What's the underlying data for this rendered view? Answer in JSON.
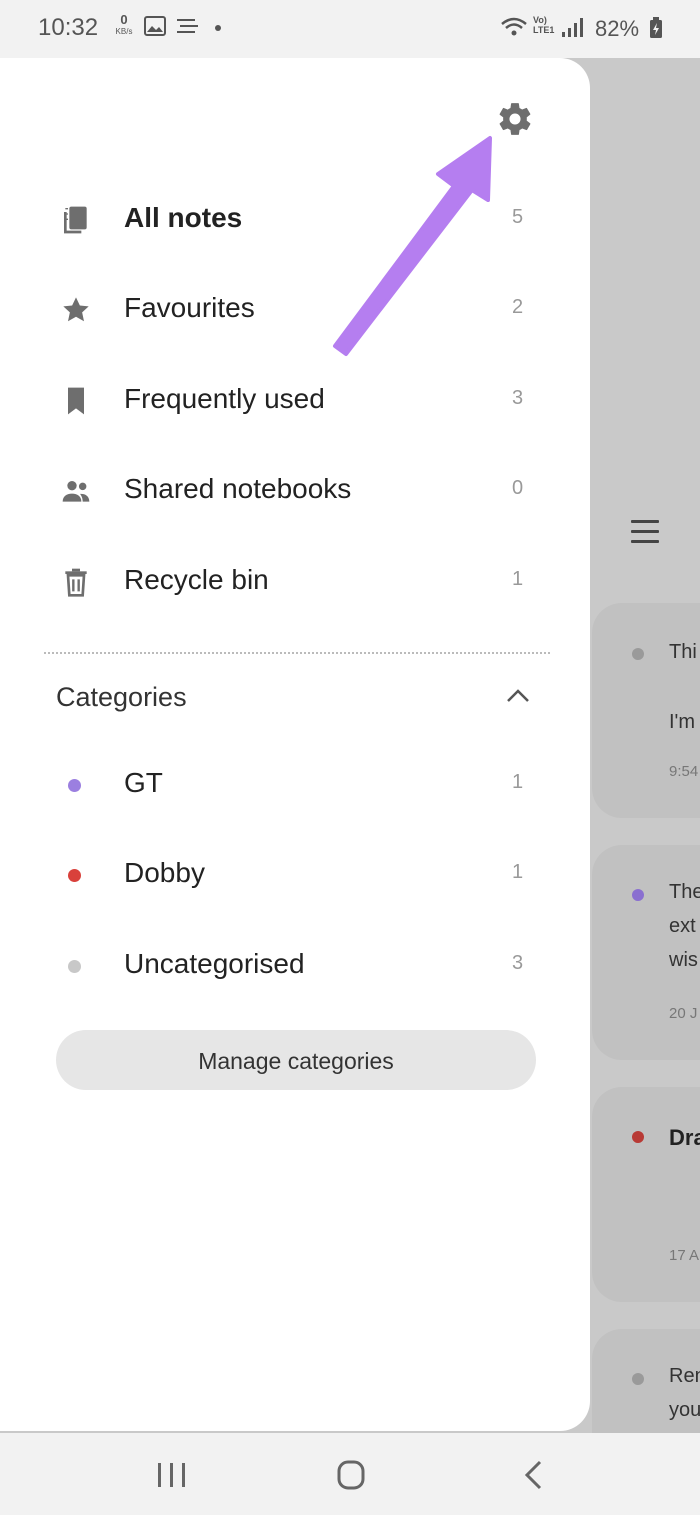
{
  "status_bar": {
    "time": "10:32",
    "net_speed": "0",
    "net_speed_unit": "KB/s",
    "battery": "82%"
  },
  "drawer": {
    "nav_items": [
      {
        "label": "All notes",
        "count": "5",
        "icon": "notes-stack-icon",
        "selected": true
      },
      {
        "label": "Favourites",
        "count": "2",
        "icon": "star-icon"
      },
      {
        "label": "Frequently used",
        "count": "3",
        "icon": "bookmark-icon"
      },
      {
        "label": "Shared notebooks",
        "count": "0",
        "icon": "people-icon"
      },
      {
        "label": "Recycle bin",
        "count": "1",
        "icon": "trash-icon"
      }
    ],
    "categories_header": "Categories",
    "categories": [
      {
        "label": "GT",
        "count": "1",
        "color": "#9b7fe0"
      },
      {
        "label": "Dobby",
        "count": "1",
        "color": "#d9413b"
      },
      {
        "label": "Uncategorised",
        "count": "3",
        "color": "#c8c8c8"
      }
    ],
    "manage_label": "Manage categories"
  },
  "notes_preview": [
    {
      "line1": "Thi",
      "line2": "I'm",
      "meta": "9:54",
      "dot_color": "#9a9a9a"
    },
    {
      "line1": "The",
      "line2": "ext",
      "line3": "wis",
      "meta": "20 J",
      "dot_color": "#8a6fd0"
    },
    {
      "title": "Dra",
      "meta": "17 A",
      "dot_color": "#b83a35"
    },
    {
      "line1": "Ren",
      "line2": "you",
      "dot_color": "#9a9a9a"
    }
  ],
  "colors": {
    "accent_arrow": "#b57ef0",
    "icon_gray": "#6e6e6e"
  }
}
